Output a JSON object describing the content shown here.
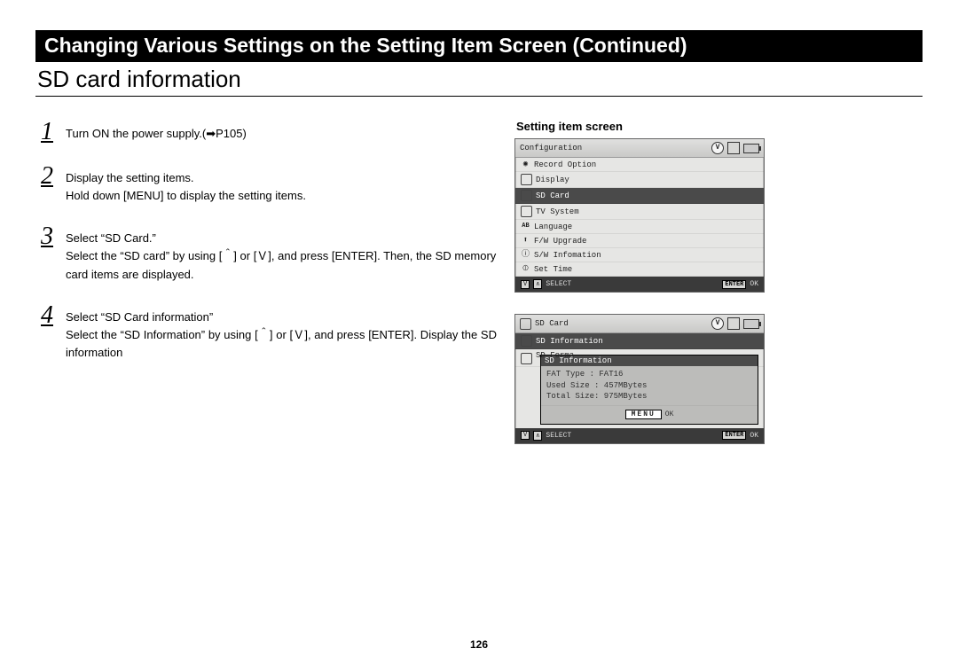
{
  "page_number": "126",
  "title": "Changing Various Settings on the Setting Item Screen (Continued)",
  "subtitle": "SD card information",
  "steps": [
    {
      "num": "1",
      "lead": "Turn ON the power supply.(➡P105)",
      "detail": ""
    },
    {
      "num": "2",
      "lead": "Display the setting items.",
      "detail": "Hold down [MENU] to display the setting items."
    },
    {
      "num": "3",
      "lead": "Select “SD Card.”",
      "detail": "Select the “SD card” by using [＾] or [Ｖ], and press [ENTER]. Then, the SD memory card items are displayed."
    },
    {
      "num": "4",
      "lead": "Select “SD Card information”",
      "detail": "Select the “SD Information” by using [＾] or [Ｖ], and press [ENTER]. Display the SD information"
    }
  ],
  "right_heading": "Setting item screen",
  "screen1": {
    "title": "Configuration",
    "items": [
      {
        "icon": "◉",
        "label": "Record Option"
      },
      {
        "icon": "□",
        "label": "Display"
      },
      {
        "icon": "▣",
        "label": "SD Card",
        "selected": true
      },
      {
        "icon": "□",
        "label": "TV System"
      },
      {
        "icon": "AB",
        "label": "Language"
      },
      {
        "icon": "⬆",
        "label": "F/W Upgrade"
      },
      {
        "icon": "ⓘ",
        "label": "S/W Infomation"
      },
      {
        "icon": "⦶",
        "label": "Set Time"
      }
    ],
    "footer_keys": "Ｖ ＾",
    "footer_select": "SELECT",
    "footer_enter_key": "ENTER",
    "footer_ok": "OK"
  },
  "screen2": {
    "title_icon": "▣",
    "title": "SD Card",
    "rows": [
      {
        "icon": "▣",
        "label": "SD Information",
        "selected": true
      },
      {
        "icon": "□",
        "label": "SD Forma"
      }
    ],
    "popup": {
      "title": "SD Information",
      "lines": [
        "FAT Type  :   FAT16",
        "Used Size :   457MBytes",
        "Total Size:   975MBytes"
      ],
      "button": "MENU",
      "ok": "OK"
    },
    "footer_keys": "Ｖ ＾",
    "footer_select": "SELECT",
    "footer_enter_key": "ENTER",
    "footer_ok": "OK"
  }
}
